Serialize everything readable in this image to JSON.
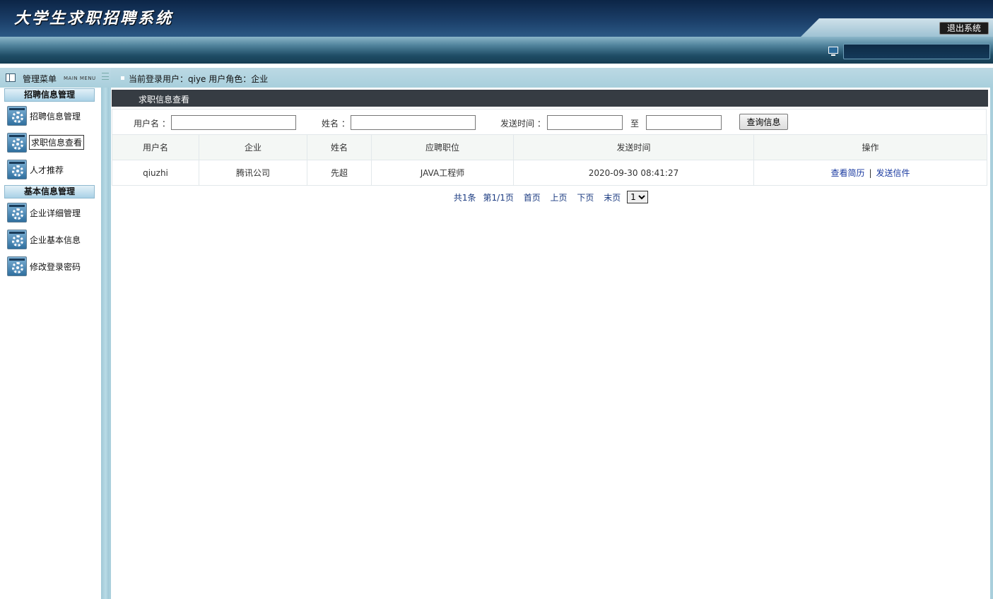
{
  "header": {
    "app_title": "大学生求职招聘系统",
    "logout_label": "退出系统"
  },
  "sidebar": {
    "title": "管理菜单",
    "title_en": "MAIN MENU",
    "groups": [
      {
        "title": "招聘信息管理",
        "items": [
          {
            "label": "招聘信息管理",
            "icon": "gear-icon"
          },
          {
            "label": "求职信息查看",
            "icon": "gear-icon"
          },
          {
            "label": "人才推荐",
            "icon": "gear-icon"
          }
        ]
      },
      {
        "title": "基本信息管理",
        "items": [
          {
            "label": "企业详细管理",
            "icon": "gear-icon"
          },
          {
            "label": "企业基本信息",
            "icon": "gear-icon"
          },
          {
            "label": "修改登录密码",
            "icon": "gear-icon"
          }
        ]
      }
    ]
  },
  "breadcrumb": {
    "text": "当前登录用户：qiye  用户角色：企业"
  },
  "panel": {
    "title": "求职信息查看"
  },
  "search": {
    "username_label": "用户名 ：",
    "username_value": "",
    "name_label": "姓名 ：",
    "name_value": "",
    "time_label": "发送时间 ：",
    "time_from_value": "",
    "to_label": "至",
    "time_to_value": "",
    "button_label": "查询信息"
  },
  "table": {
    "columns": [
      "用户名",
      "企业",
      "姓名",
      "应聘职位",
      "发送时间",
      "操作"
    ],
    "rows": [
      {
        "username": "qiuzhi",
        "company": "腾讯公司",
        "name": "先超",
        "position": "JAVA工程师",
        "send_time": "2020-09-30 08:41:27",
        "actions": [
          "查看简历",
          "发送信件"
        ]
      }
    ]
  },
  "pager": {
    "total": "共1条",
    "page_info": "第1/1页",
    "first": "首页",
    "prev": "上页",
    "next": "下页",
    "last": "末页",
    "selected_page": "1"
  },
  "colors": {
    "header_dark": "#0c2546",
    "accent_light": "#a9cfdc",
    "panel_title_bg": "#363c43",
    "link": "#1a3aa0"
  }
}
